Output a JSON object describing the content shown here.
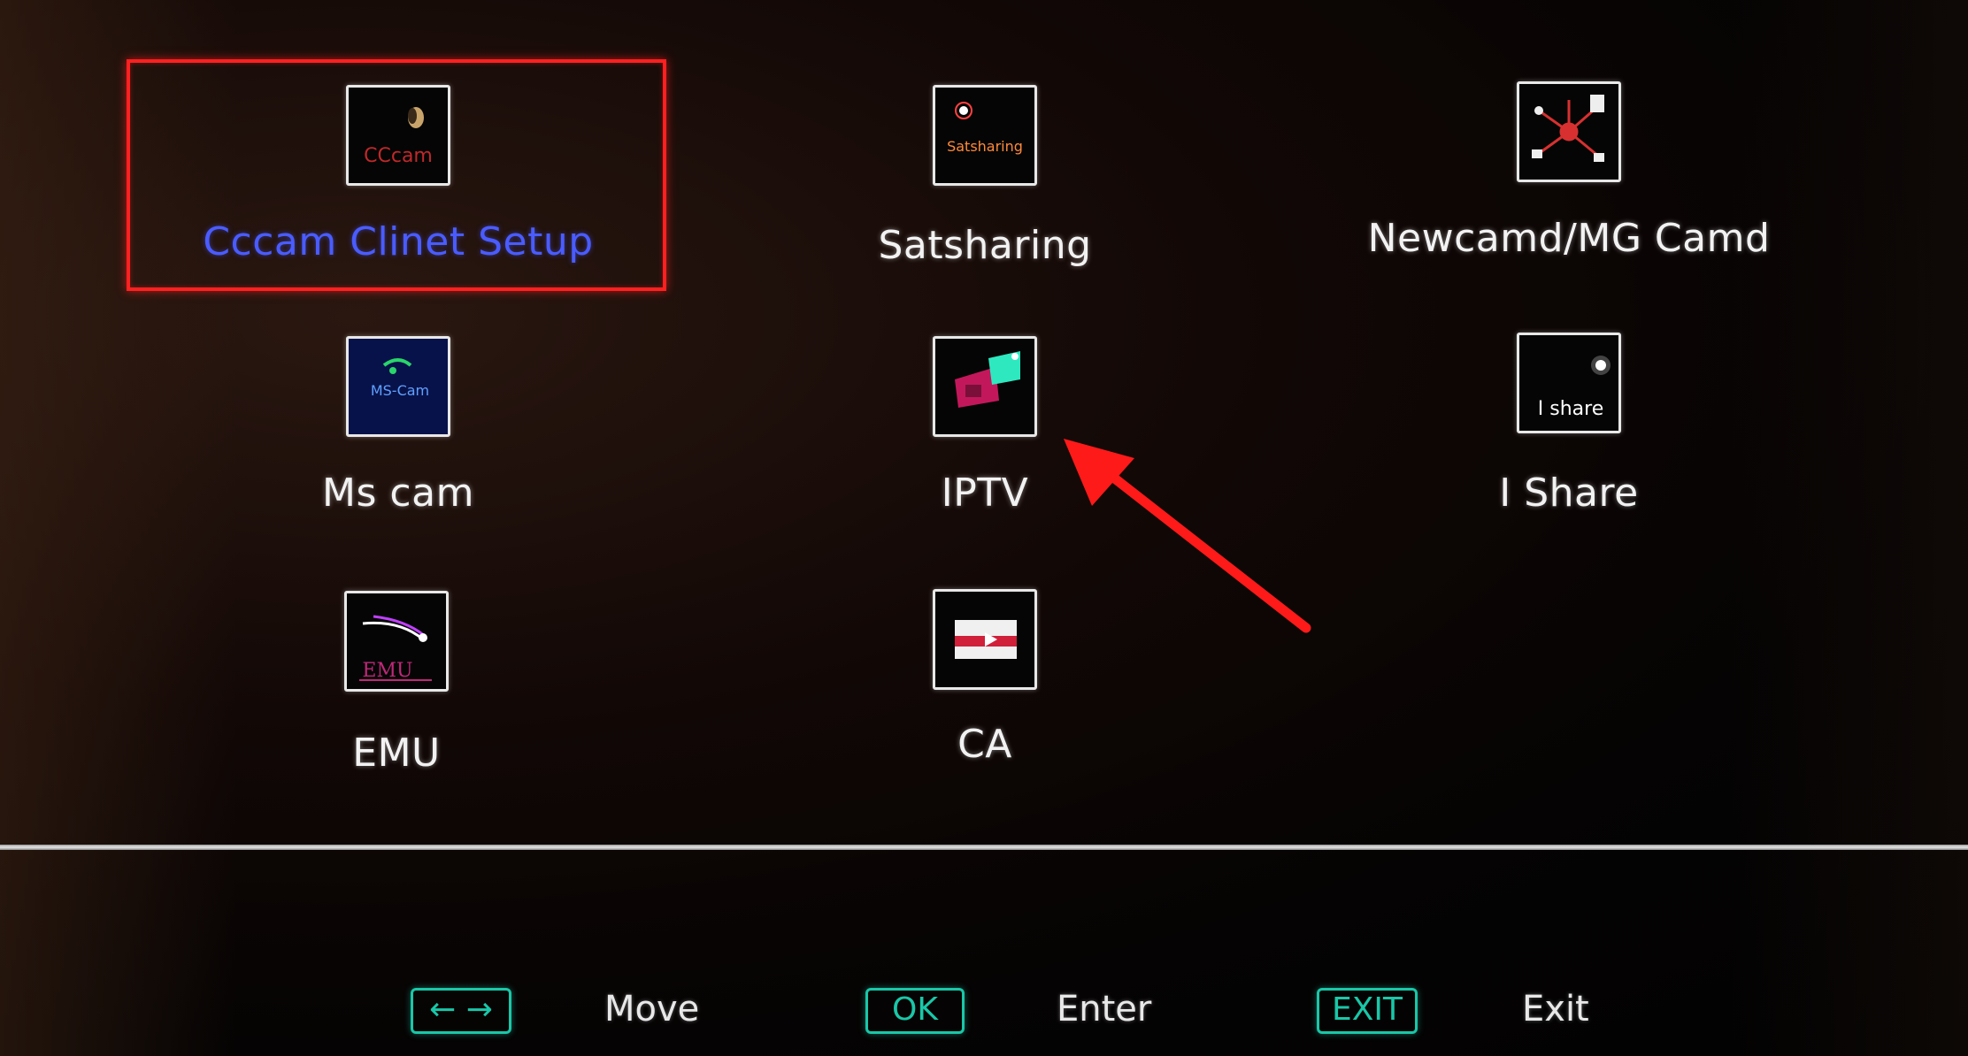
{
  "menu": {
    "items": [
      {
        "label": "Cccam Clinet Setup",
        "icon": "cccam-icon",
        "icon_text": "CCcam",
        "selected": true
      },
      {
        "label": "Satsharing",
        "icon": "satsharing-icon",
        "icon_text": "Satsharing",
        "selected": false
      },
      {
        "label": "Newcamd/MG Camd",
        "icon": "newcamd-network-icon",
        "selected": false
      },
      {
        "label": "Ms cam",
        "icon": "mscam-icon",
        "icon_text": "MS-Cam",
        "selected": false
      },
      {
        "label": "IPTV",
        "icon": "iptv-icon",
        "selected": false
      },
      {
        "label": "I Share",
        "icon": "ishare-icon",
        "icon_text": "I share",
        "selected": false
      },
      {
        "label": "EMU",
        "icon": "emu-icon",
        "icon_text": "EMU",
        "selected": false
      },
      {
        "label": "CA",
        "icon": "ca-card-icon",
        "selected": false
      }
    ]
  },
  "footer": {
    "move_key": "← →",
    "move_label": "Move",
    "ok_key": "OK",
    "ok_label": "Enter",
    "exit_key": "EXIT",
    "exit_label": "Exit"
  },
  "colors": {
    "selection_border": "#ff2020",
    "selected_text": "#4a5cff",
    "footer_key": "#19c7a8",
    "annotation_arrow": "#ff1a1a"
  }
}
